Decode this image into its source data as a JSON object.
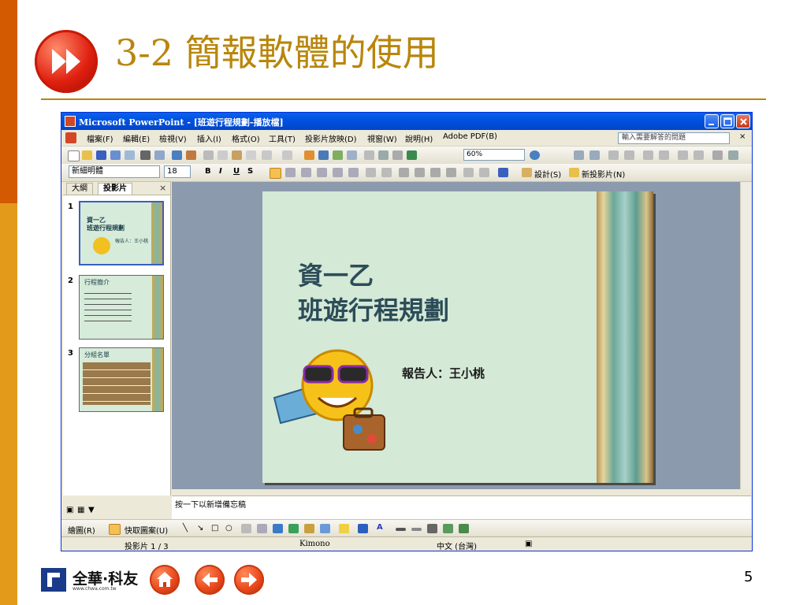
{
  "colors": {
    "left_bar_top": "#d35a00",
    "left_bar_bottom": "#e39a1a",
    "title_color": "#b8860b",
    "rule_color": "#b8860b"
  },
  "slide": {
    "title": "3-2 簡報軟體的使用",
    "page_number": "5",
    "logo_text": "全華·科友",
    "logo_sub": "www.chwa.com.tw"
  },
  "window": {
    "title": "Microsoft PowerPoint - [班遊行程規劃-播放檔]",
    "menus": [
      "檔案(F)",
      "編輯(E)",
      "檢視(V)",
      "插入(I)",
      "格式(O)",
      "工具(T)",
      "投影片放映(D)",
      "視窗(W)",
      "說明(H)",
      "Adobe PDF(B)"
    ],
    "help_placeholder": "輸入需要解答的問題",
    "zoom": "60%",
    "font_name": "新細明體",
    "font_size": "18",
    "design_label": "設計(S)",
    "new_slide_label": "新投影片(N)"
  },
  "panel": {
    "tabs": [
      "大綱",
      "投影片"
    ],
    "thumbs": [
      {
        "num": "1",
        "line1": "資一乙",
        "line2": "班遊行程規劃",
        "line3": "報告人：王小桃"
      },
      {
        "num": "2",
        "line1": "行程簡介"
      },
      {
        "num": "3",
        "line1": "分組名單"
      }
    ]
  },
  "current_slide": {
    "title_line1": "資一乙",
    "title_line2": "班遊行程規劃",
    "reporter": "報告人：王小桃"
  },
  "notes_placeholder": "按一下以新增備忘稿",
  "draw_toolbar": {
    "draw_label": "繪圖(R)",
    "autoshapes_label": "快取圖案(U)"
  },
  "status": {
    "slide_count": "投影片 1 / 3",
    "template": "Kimono",
    "language": "中文 (台灣)"
  }
}
